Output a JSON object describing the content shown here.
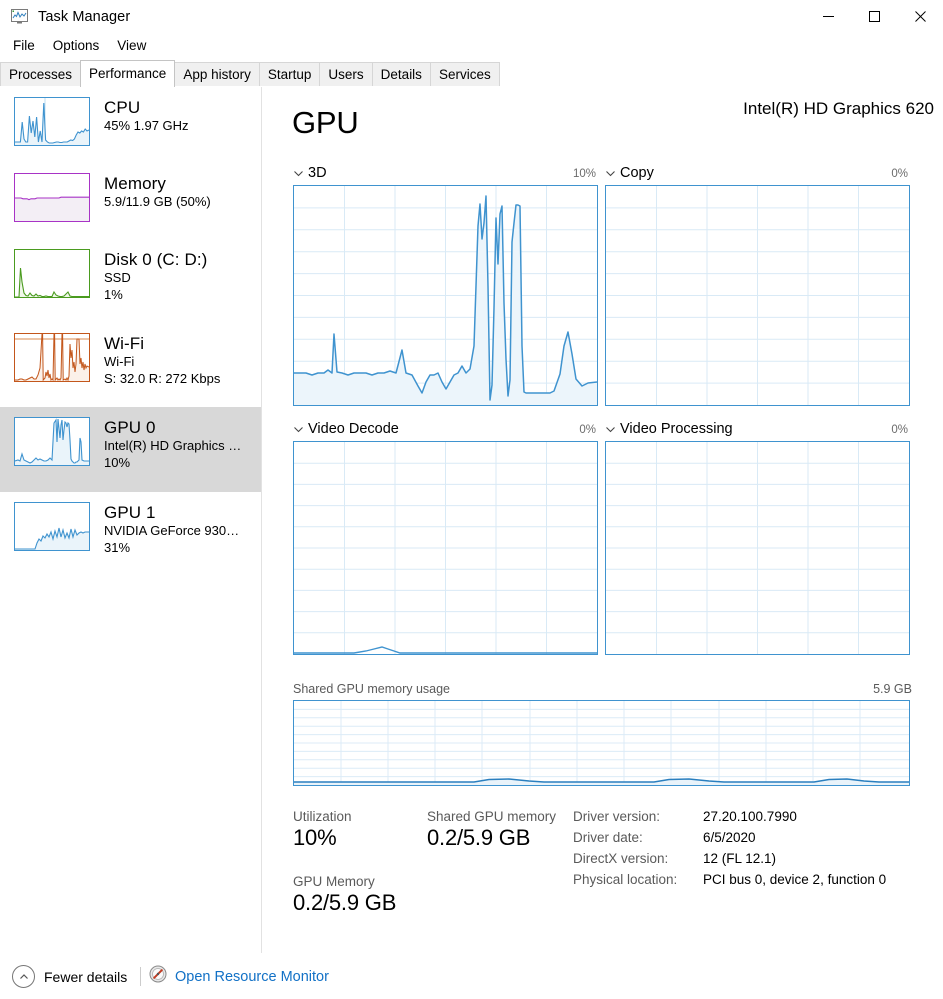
{
  "window": {
    "title": "Task Manager",
    "icon": "task-manager-icon",
    "minimize": "–",
    "maximize": "□",
    "close": "✕"
  },
  "menubar": {
    "items": [
      {
        "label": "File"
      },
      {
        "label": "Options"
      },
      {
        "label": "View"
      }
    ]
  },
  "tabs": [
    {
      "label": "Processes",
      "active": false
    },
    {
      "label": "Performance",
      "active": true
    },
    {
      "label": "App history",
      "active": false
    },
    {
      "label": "Startup",
      "active": false
    },
    {
      "label": "Users",
      "active": false
    },
    {
      "label": "Details",
      "active": false
    },
    {
      "label": "Services",
      "active": false
    }
  ],
  "sidebar": {
    "items": [
      {
        "name": "cpu",
        "title": "CPU",
        "sub1": "45%  1.97 GHz",
        "sub2": "",
        "color": "#3f93cf",
        "fill": "#eef6fb",
        "selected": false
      },
      {
        "name": "memory",
        "title": "Memory",
        "sub1": "5.9/11.9 GB (50%)",
        "sub2": "",
        "color": "#a833c6",
        "fill": "#f2eef4",
        "selected": false
      },
      {
        "name": "disk-0",
        "title": "Disk 0 (C: D:)",
        "sub1": "SSD",
        "sub2": "1%",
        "color": "#4a9b1f",
        "fill": "#f1f7ec",
        "selected": false
      },
      {
        "name": "wifi",
        "title": "Wi-Fi",
        "sub1": "Wi-Fi",
        "sub2": "S: 32.0 R: 272 Kbps",
        "color": "#c3561b",
        "fill": "#fbf0e8",
        "selected": false
      },
      {
        "name": "gpu-0",
        "title": "GPU 0",
        "sub1": "Intel(R) HD Graphics …",
        "sub2": "10%",
        "color": "#3f93cf",
        "fill": "#eef6fb",
        "selected": true
      },
      {
        "name": "gpu-1",
        "title": "GPU 1",
        "sub1": "NVIDIA GeForce 930…",
        "sub2": "31%",
        "color": "#3f93cf",
        "fill": "#eef6fb",
        "selected": false
      }
    ]
  },
  "main": {
    "heading": "GPU",
    "device": "Intel(R) HD Graphics 620",
    "graphs": [
      {
        "name": "3d",
        "label": "3D",
        "percent": "10%"
      },
      {
        "name": "copy",
        "label": "Copy",
        "percent": "0%"
      },
      {
        "name": "video-decode",
        "label": "Video Decode",
        "percent": "0%"
      },
      {
        "name": "video-processing",
        "label": "Video Processing",
        "percent": "0%"
      }
    ],
    "shared_memory_graph": {
      "label": "Shared GPU memory usage",
      "max": "5.9 GB"
    },
    "stats": [
      {
        "name": "utilization",
        "label": "Utilization",
        "value": "10%"
      },
      {
        "name": "gpu-memory",
        "label": "GPU Memory",
        "value": "0.2/5.9 GB"
      },
      {
        "name": "shared-gpu-memory",
        "label": "Shared GPU memory",
        "value": "0.2/5.9 GB"
      }
    ],
    "info": [
      {
        "name": "driver-version",
        "label": "Driver version:",
        "value": "27.20.100.7990"
      },
      {
        "name": "driver-date",
        "label": "Driver date:",
        "value": "6/5/2020"
      },
      {
        "name": "directx-version",
        "label": "DirectX version:",
        "value": "12 (FL 12.1)"
      },
      {
        "name": "physical-location",
        "label": "Physical location:",
        "value": "PCI bus 0, device 2, function 0"
      }
    ]
  },
  "footer": {
    "fewer_details": "Fewer details",
    "open_resource_monitor": "Open Resource Monitor"
  },
  "chart_data": [
    {
      "type": "area",
      "name": "3d",
      "title": "3D",
      "ylim": [
        0,
        100
      ],
      "current": 10,
      "grid": {
        "cols": 6,
        "rows": 10
      },
      "values": [
        6,
        6,
        6,
        5,
        6,
        6,
        7,
        6,
        6,
        24,
        7,
        6,
        5,
        6,
        6,
        7,
        6,
        6,
        5,
        6,
        7,
        6,
        6,
        7,
        16,
        6,
        5,
        1,
        3,
        5,
        5,
        6,
        5,
        3,
        1,
        3,
        5,
        6,
        9,
        6,
        5,
        6,
        8,
        38,
        88,
        92,
        72,
        98,
        99,
        35,
        2,
        40,
        88,
        60,
        86,
        96,
        57,
        70,
        92,
        92,
        84,
        32,
        10,
        21,
        16,
        89,
        97,
        92,
        22,
        3,
        3,
        3,
        3,
        3,
        3,
        3,
        18,
        28,
        14,
        4,
        5
      ]
    },
    {
      "type": "area",
      "name": "copy",
      "title": "Copy",
      "ylim": [
        0,
        100
      ],
      "current": 0,
      "grid": {
        "cols": 6,
        "rows": 10
      },
      "values": [
        0,
        0,
        0,
        0,
        0,
        0,
        0,
        0,
        0,
        0,
        0,
        0,
        0,
        0,
        0,
        0,
        0,
        0,
        0,
        0,
        0,
        0,
        0,
        0,
        0,
        0,
        0,
        0,
        0,
        0,
        0,
        0,
        0,
        0,
        0,
        0,
        0,
        0,
        0,
        0,
        0
      ]
    },
    {
      "type": "area",
      "name": "video-decode",
      "title": "Video Decode",
      "ylim": [
        0,
        100
      ],
      "current": 0,
      "grid": {
        "cols": 6,
        "rows": 10
      },
      "values": [
        0,
        0,
        0,
        0,
        0,
        0,
        0,
        0,
        0,
        0,
        1,
        2,
        3,
        2,
        1,
        0,
        0,
        0,
        0,
        0,
        0,
        0,
        0,
        0,
        0,
        0,
        0,
        0,
        0,
        0,
        0,
        0,
        0,
        0,
        0,
        0,
        0,
        0,
        0,
        0,
        0
      ]
    },
    {
      "type": "area",
      "name": "video-processing",
      "title": "Video Processing",
      "ylim": [
        0,
        100
      ],
      "current": 0,
      "grid": {
        "cols": 6,
        "rows": 10
      },
      "values": [
        0,
        0,
        0,
        0,
        0,
        0,
        0,
        0,
        0,
        0,
        0,
        0,
        0,
        0,
        0,
        0,
        0,
        0,
        0,
        0,
        0,
        0,
        0,
        0,
        0,
        0,
        0,
        0,
        0,
        0,
        0,
        0,
        0,
        0,
        0,
        0,
        0,
        0,
        0,
        0,
        0
      ]
    },
    {
      "type": "area",
      "name": "shared-gpu-memory-usage",
      "title": "Shared GPU memory usage",
      "ylabel": "GB",
      "ylim": [
        0,
        5.9
      ],
      "current": 0.2,
      "grid": {
        "cols": 13,
        "rows": 10
      },
      "values": [
        0.18,
        0.18,
        0.18,
        0.18,
        0.18,
        0.18,
        0.18,
        0.18,
        0.18,
        0.18,
        0.18,
        0.18,
        0.18,
        0.18,
        0.18,
        0.22,
        0.25,
        0.22,
        0.18,
        0.18,
        0.18,
        0.18,
        0.18,
        0.18,
        0.18,
        0.18,
        0.18,
        0.18,
        0.22,
        0.25,
        0.22,
        0.18,
        0.18,
        0.18,
        0.18,
        0.18,
        0.18,
        0.18,
        0.18,
        0.18,
        0.18,
        0.18,
        0.22,
        0.25,
        0.22,
        0.18,
        0.18,
        0.18,
        0.18,
        0.18
      ]
    },
    {
      "type": "area",
      "name": "cpu-thumbnail",
      "title": "CPU",
      "ylim": [
        0,
        100
      ],
      "current": 45,
      "values": [
        6,
        6,
        6,
        6,
        42,
        8,
        6,
        6,
        60,
        20,
        48,
        14,
        58,
        6,
        22,
        6,
        88,
        10,
        6,
        4,
        4,
        4,
        5,
        6,
        6,
        5,
        5,
        6,
        6,
        6,
        8,
        10,
        9,
        12,
        20,
        26,
        24,
        30,
        26,
        34,
        30
      ]
    },
    {
      "type": "area",
      "name": "memory-thumbnail",
      "title": "Memory",
      "ylim": [
        0,
        100
      ],
      "current": 50,
      "values": [
        50,
        50,
        50,
        50,
        49,
        50,
        49,
        50,
        50,
        50,
        50,
        50,
        50,
        50,
        50,
        50,
        50,
        50,
        50,
        50,
        50,
        50,
        50,
        50,
        50,
        50,
        50,
        51,
        51,
        51,
        51,
        51,
        51,
        51,
        51,
        51,
        51,
        51,
        51,
        51,
        51
      ]
    },
    {
      "type": "area",
      "name": "disk-thumbnail",
      "title": "Disk 0",
      "ylim": [
        0,
        100
      ],
      "current": 1,
      "values": [
        0,
        0,
        0,
        60,
        30,
        8,
        3,
        2,
        2,
        8,
        3,
        2,
        6,
        2,
        3,
        2,
        2,
        1,
        1,
        2,
        1,
        1,
        1,
        1,
        1,
        1,
        1,
        3,
        6,
        3,
        2,
        1,
        1,
        2,
        5,
        8,
        2,
        1,
        1,
        1,
        1
      ]
    },
    {
      "type": "area",
      "name": "wifi-thumbnail",
      "title": "Wi-Fi",
      "ylim": [
        0,
        100
      ],
      "current": 32,
      "values": [
        2,
        3,
        4,
        10,
        6,
        4,
        2,
        3,
        2,
        2,
        6,
        12,
        8,
        98,
        96,
        10,
        4,
        3,
        2,
        96,
        98,
        20,
        6,
        4,
        3,
        2,
        4,
        10,
        6,
        4,
        3,
        6,
        70,
        74,
        40,
        20,
        16,
        46,
        42,
        60,
        58
      ]
    },
    {
      "type": "area",
      "name": "gpu0-thumbnail",
      "title": "GPU 0",
      "ylim": [
        0,
        100
      ],
      "current": 10,
      "values": [
        8,
        10,
        8,
        24,
        10,
        8,
        6,
        4,
        6,
        10,
        14,
        10,
        12,
        10,
        8,
        8,
        10,
        12,
        10,
        88,
        96,
        40,
        98,
        60,
        90,
        96,
        58,
        72,
        94,
        90,
        82,
        20,
        8,
        6,
        5,
        5,
        6,
        6,
        40,
        34,
        8
      ]
    },
    {
      "type": "area",
      "name": "gpu1-thumbnail",
      "title": "GPU 1",
      "ylim": [
        0,
        100
      ],
      "current": 31,
      "values": [
        2,
        2,
        2,
        2,
        2,
        2,
        2,
        2,
        2,
        2,
        2,
        2,
        14,
        20,
        16,
        26,
        22,
        30,
        24,
        38,
        20,
        40,
        26,
        52,
        20,
        44,
        24,
        36,
        20,
        48,
        26,
        44,
        30,
        38,
        42,
        40,
        38,
        40,
        42,
        42,
        42
      ]
    }
  ]
}
